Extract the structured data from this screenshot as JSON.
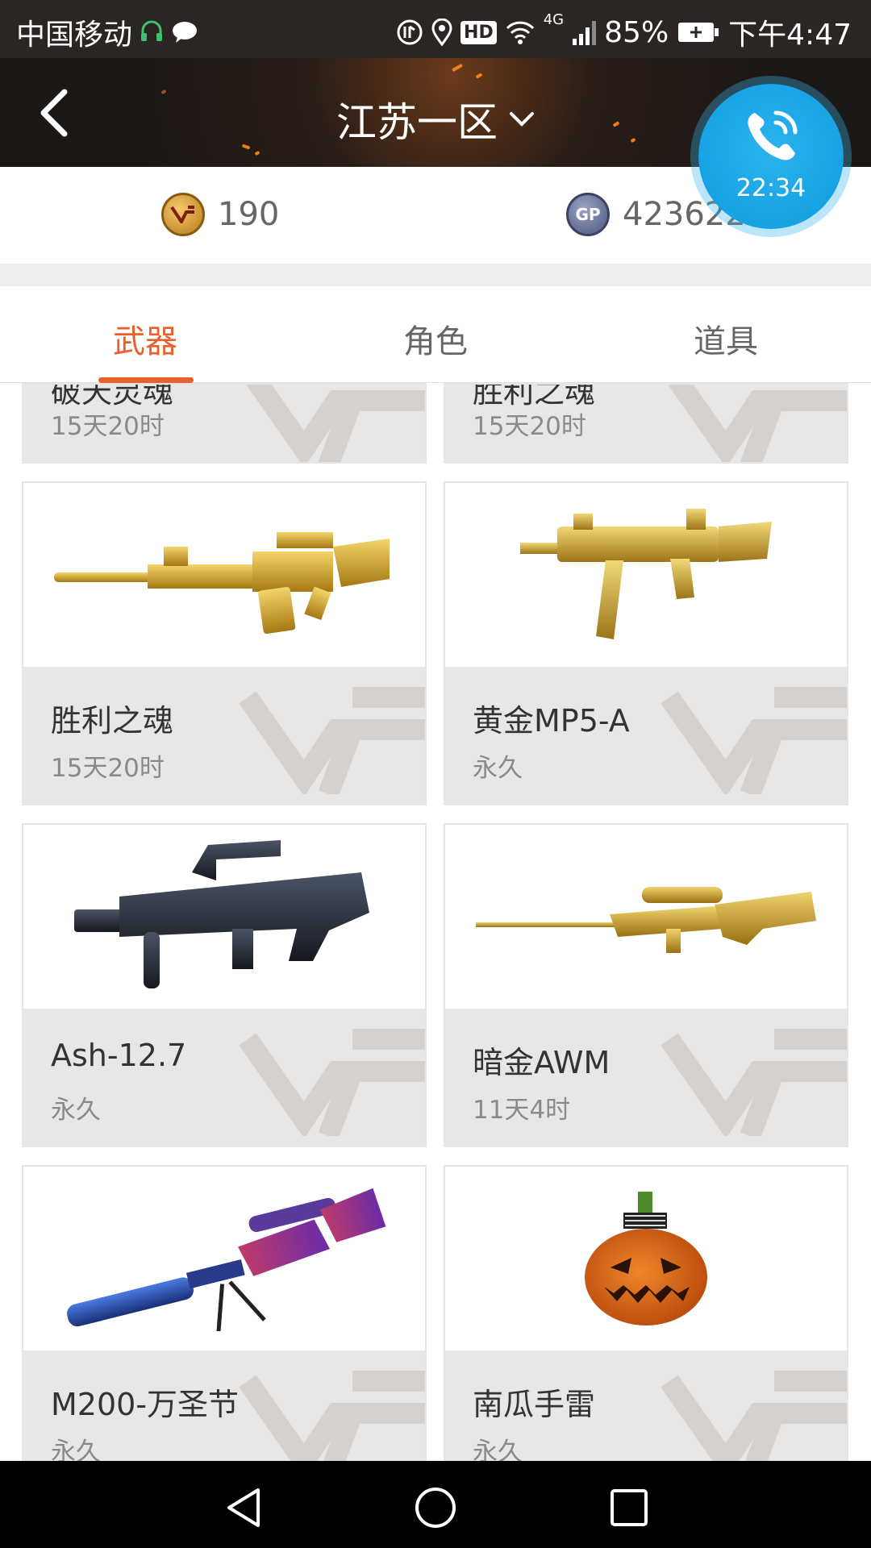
{
  "status_bar": {
    "carrier": "中国移动",
    "battery": "85%",
    "network": "4G",
    "hd": "HD",
    "time": "下午4:47"
  },
  "header": {
    "title": "江苏一区"
  },
  "call": {
    "duration": "22:34"
  },
  "currency": {
    "cf_points": "190",
    "gp": "423622",
    "gp_coin_label": "GP"
  },
  "tabs": [
    {
      "label": "武器",
      "active": true
    },
    {
      "label": "角色",
      "active": false
    },
    {
      "label": "道具",
      "active": false
    }
  ],
  "items": [
    {
      "name": "破天灵魂",
      "duration": "15天20时",
      "image": "weapon"
    },
    {
      "name": "胜利之魂",
      "duration": "15天20时",
      "image": "weapon"
    },
    {
      "name": "胜利之魂",
      "duration": "15天20时",
      "image": "gold-m4a1"
    },
    {
      "name": "黄金MP5-A",
      "duration": "永久",
      "image": "gold-mp5"
    },
    {
      "name": "Ash-12.7",
      "duration": "永久",
      "image": "ash-rifle"
    },
    {
      "name": "暗金AWM",
      "duration": "11天4时",
      "image": "gold-awm"
    },
    {
      "name": "M200-万圣节",
      "duration": "永久",
      "image": "halloween-sniper"
    },
    {
      "name": "南瓜手雷",
      "duration": "永久",
      "image": "pumpkin-grenade"
    }
  ],
  "colors": {
    "accent": "#e8602c",
    "call_blue": "#17a2e4",
    "card_info_bg": "#e9e7e5"
  }
}
